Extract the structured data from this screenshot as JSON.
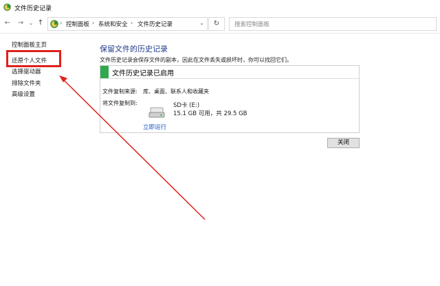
{
  "window": {
    "title": "文件历史记录"
  },
  "nav": {
    "back_icon": "←",
    "forward_icon": "→",
    "recent_icon": "⌄",
    "up_icon": "↑",
    "breadcrumb": [
      "控制面板",
      "系统和安全",
      "文件历史记录"
    ],
    "separator": "›",
    "dropdown_icon": "⌄",
    "refresh_icon": "↻",
    "search_placeholder": "搜索控制面板"
  },
  "sidebar": {
    "items": [
      {
        "label": "控制面板主页"
      },
      {
        "label": "还原个人文件"
      },
      {
        "label": "选择驱动器"
      },
      {
        "label": "排除文件夹"
      },
      {
        "label": "高级设置"
      }
    ]
  },
  "main": {
    "heading": "保留文件的历史记录",
    "description": "文件历史记录会保存文件的副本，因此在文件丢失或损坏时，你可以找回它们。",
    "status": "文件历史记录已启用",
    "copy_from_label": "文件复制来源:",
    "copy_from_value": "库、桌面、联系人和收藏夹",
    "copy_to_label": "将文件复制到:",
    "drive_name": "SD卡 (E:)",
    "drive_space": "15.1 GB 可用，共 29.5 GB",
    "run_now": "立即运行",
    "close_button": "关闭"
  },
  "colors": {
    "status_green": "#2fa84f",
    "heading_blue": "#1e3a8a",
    "link_blue": "#1a56c4",
    "annotation_red": "#e0201b"
  }
}
